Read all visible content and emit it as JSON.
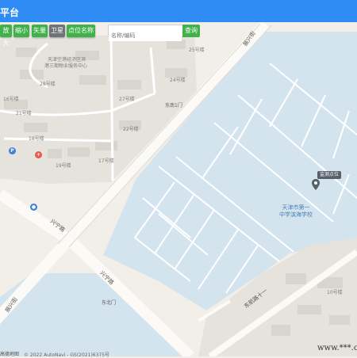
{
  "header": {
    "title": "平台"
  },
  "toolbar": {
    "zoom_in": "放大",
    "zoom_out": "缩小",
    "vector": "矢量",
    "satellite": "卫星",
    "point_names": "点位名称",
    "search_placeholder": "名称/编码",
    "search_button": "查询"
  },
  "map": {
    "area_labels": [
      "天津空港经济区滨",
      "港三期物业服务中心",
      "25号楼",
      "28号楼",
      "27号楼",
      "24号楼",
      "21号楼",
      "22号楼",
      "18号楼",
      "17号楼",
      "19号楼",
      "16号楼",
      "东南1门",
      "东北门",
      "10号楼"
    ],
    "road_labels": [
      "振兴街",
      "兴宁路",
      "兴宁路",
      "振兴街",
      "东航路十一"
    ],
    "school_name_line1": "天津市第一",
    "school_name_line2": "中学滨海学校",
    "monitor_point_label": "监测点位",
    "logo": "高德地图",
    "copyright": "© 2022 AutoNavi - GS(2021)6375号"
  },
  "watermark": "www.***.com",
  "colors": {
    "header": "#2f8cf4",
    "button_green": "#3fb24a",
    "button_gray": "#6f7378",
    "water": "#d4e4ef"
  }
}
